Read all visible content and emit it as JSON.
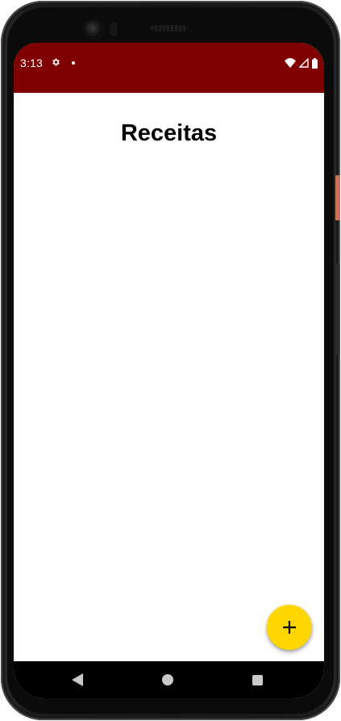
{
  "status_bar": {
    "time": "3:13",
    "background_color": "#800000",
    "icons": [
      "gear-icon",
      "notification-dot-icon",
      "wifi-icon",
      "signal-icon",
      "battery-icon"
    ]
  },
  "page": {
    "title": "Receitas"
  },
  "fab": {
    "icon": "plus-icon",
    "color": "#ffd600"
  },
  "navigation_bar": {
    "icons": [
      "back-icon",
      "home-icon",
      "recents-icon"
    ]
  }
}
